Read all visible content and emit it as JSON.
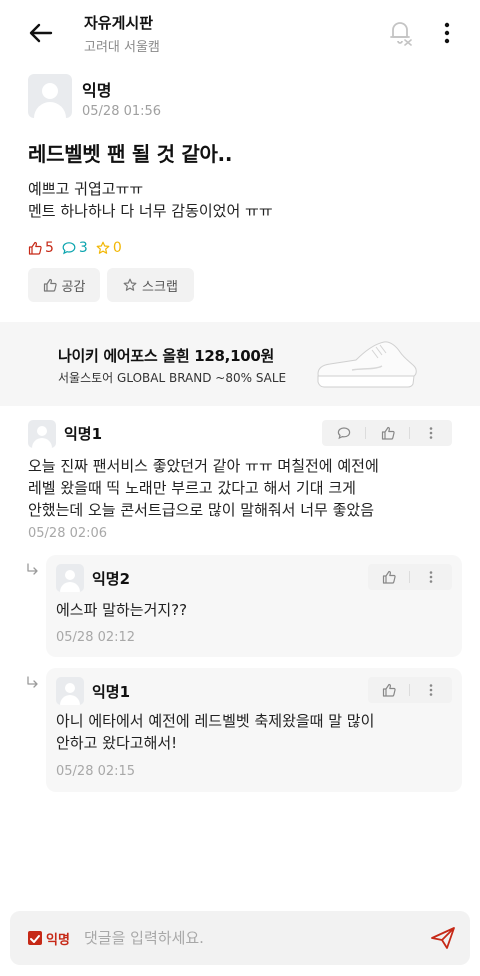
{
  "header": {
    "title": "자유게시판",
    "subtitle": "고려대 서울캠"
  },
  "post": {
    "author": "익명",
    "time": "05/28 01:56",
    "title": "레드벨벳 팬 될 것 같아..",
    "body_lines": [
      "예쁘고 귀엽고ㅠㅠ",
      "멘트 하나하나 다 너무 감동이었어 ㅠㅠ"
    ],
    "like_count": "5",
    "comment_count": "3",
    "scrap_count": "0",
    "like_button": "공감",
    "scrap_button": "스크랩"
  },
  "ad": {
    "title": "나이키 에어포스 올흰 128,100원",
    "subtitle": "서울스토어 GLOBAL BRAND ~80% SALE"
  },
  "comments": [
    {
      "author": "익명1",
      "body_lines": [
        "오늘 진짜 팬서비스 좋았던거 같아 ㅠㅠ 며칠전에 예전에",
        "레벨 왔을때 띡 노래만 부르고 갔다고 해서 기대 크게",
        "안했는데 오늘 콘서트급으로 많이 말해줘서 너무 좋았음"
      ],
      "time": "05/28 02:06"
    },
    {
      "author": "익명2",
      "body_lines": [
        "에스파 말하는거지??"
      ],
      "time": "05/28 02:12"
    },
    {
      "author": "익명1",
      "body_lines": [
        "아니 에타에서 예전에 레드벨벳 축제왔을때 말 많이",
        "안하고 왔다고해서!"
      ],
      "time": "05/28 02:15"
    }
  ],
  "input": {
    "anon_label": "익명",
    "placeholder": "댓글을 입력하세요."
  },
  "colors": {
    "accent": "#c62917",
    "comment": "#0ca5af",
    "scrap": "#f2b705"
  }
}
